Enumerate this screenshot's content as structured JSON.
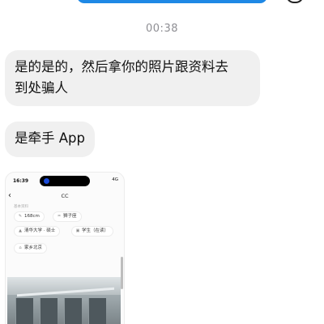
{
  "chat": {
    "timestamp": "00:38",
    "messages": [
      {
        "text_line1": "是的是的，然后拿你的照片跟资料去",
        "text_line2": "到处骗人"
      },
      {
        "text": "是牵手 App"
      }
    ]
  },
  "colors": {
    "sent_bubble": "#1e88e5",
    "received_bubble": "#f0f0f0",
    "timestamp": "#8e8e93"
  },
  "attachment": {
    "status_time": "16:39",
    "status_right": "4G",
    "nav_back": "‹",
    "nav_title": "CC",
    "section_label": "基本资料",
    "chips": [
      {
        "icon": "ruler-icon",
        "glyph": "✎",
        "label": "168cm"
      },
      {
        "icon": "star-sign-icon",
        "glyph": "♒",
        "label": "狮子座"
      },
      {
        "icon": "graduation-cap-icon",
        "glyph": "▲",
        "label": "清华大学 · 硕士"
      },
      {
        "icon": "briefcase-icon",
        "glyph": "▣",
        "label": "学生（在读）"
      },
      {
        "icon": "home-icon",
        "glyph": "⌂",
        "label": "家乡北京"
      }
    ]
  }
}
